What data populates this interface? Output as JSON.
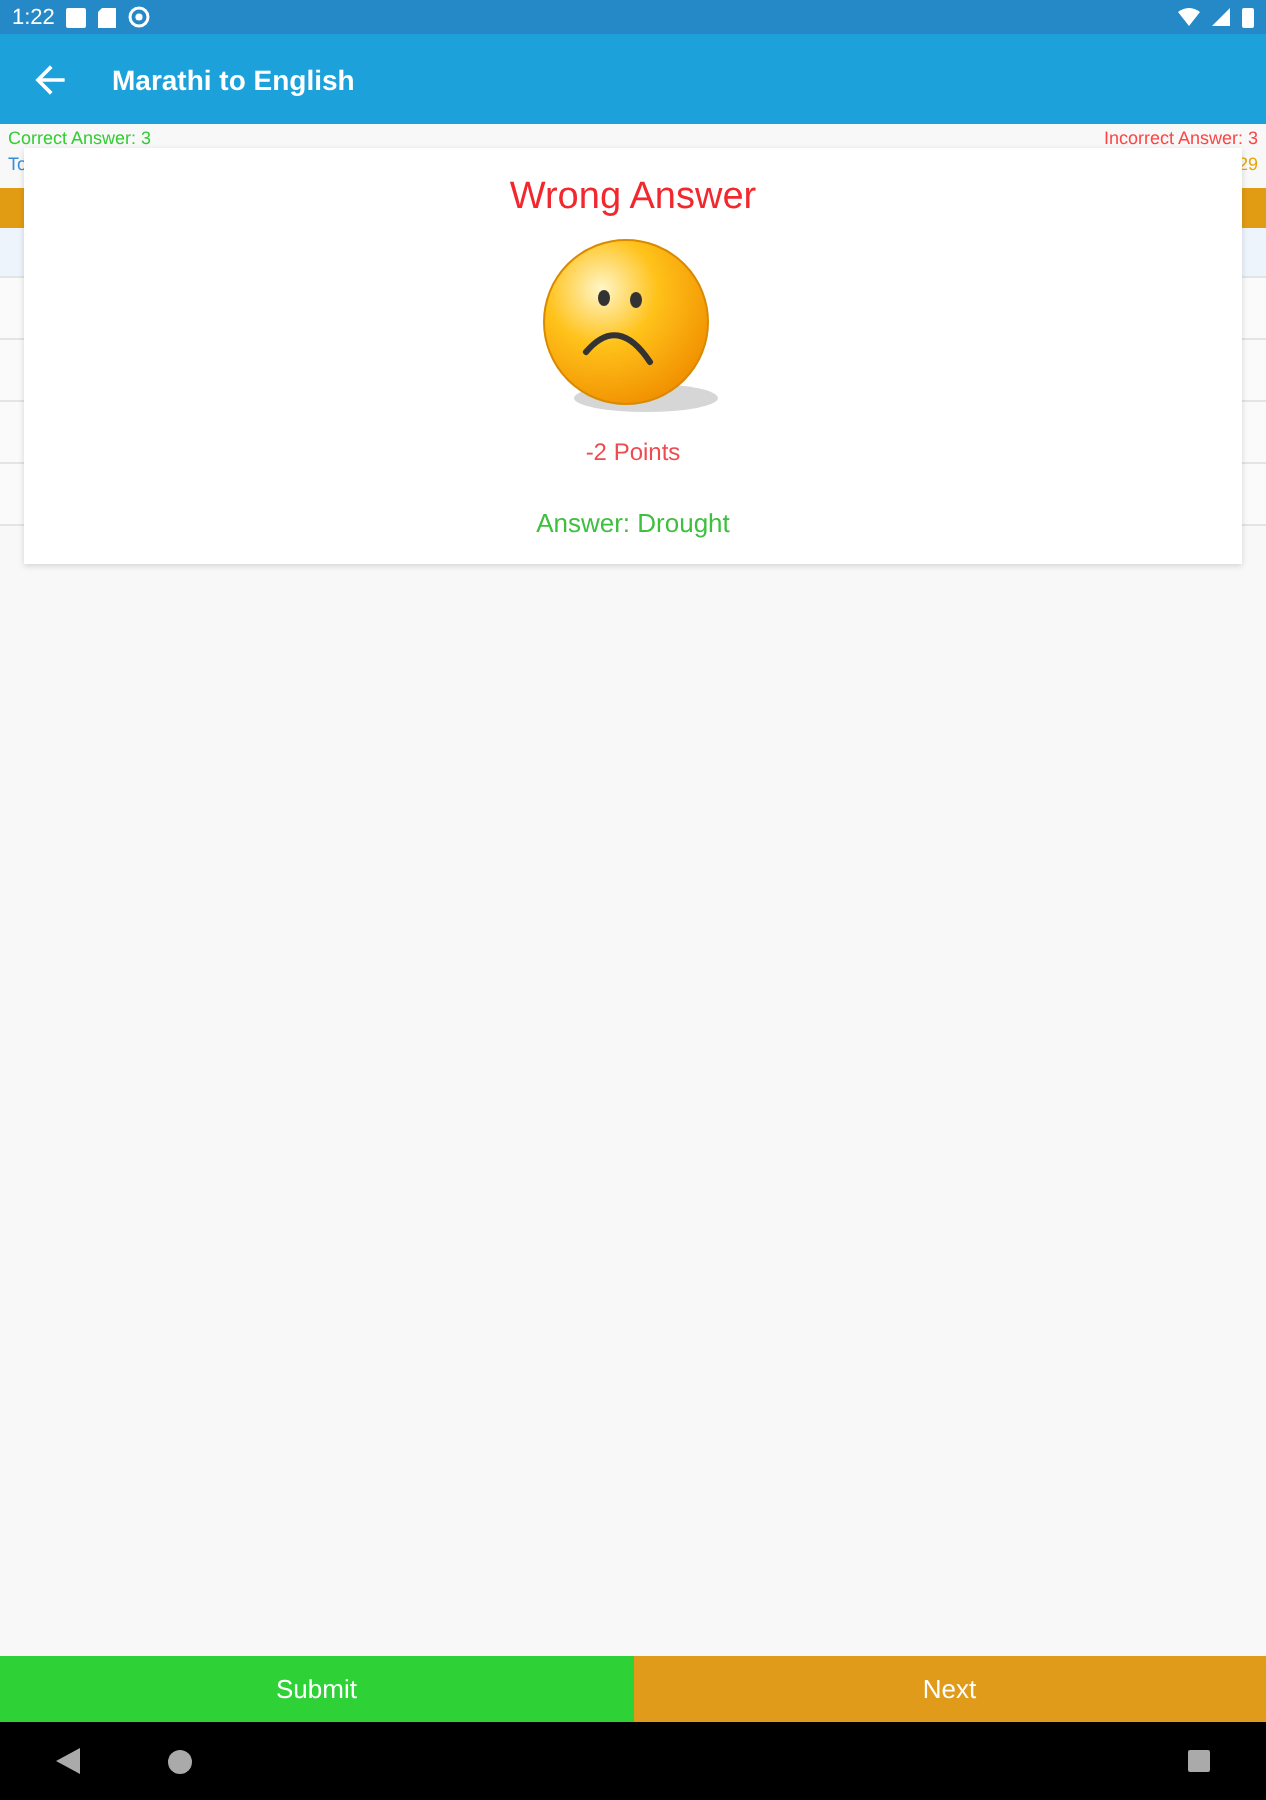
{
  "status_bar": {
    "time": "1:22"
  },
  "app_bar": {
    "title": "Marathi to English"
  },
  "score": {
    "correct": "Correct Answer: 3",
    "incorrect": "Incorrect Answer: 3",
    "total_start": "To",
    "total_end": "29"
  },
  "dialog": {
    "title": "Wrong Answer",
    "points": "-2 Points",
    "answer": "Answer: Drought"
  },
  "buttons": [
    {
      "label": "Submit",
      "kind": "submit"
    },
    {
      "label": "Next",
      "kind": "next"
    }
  ]
}
